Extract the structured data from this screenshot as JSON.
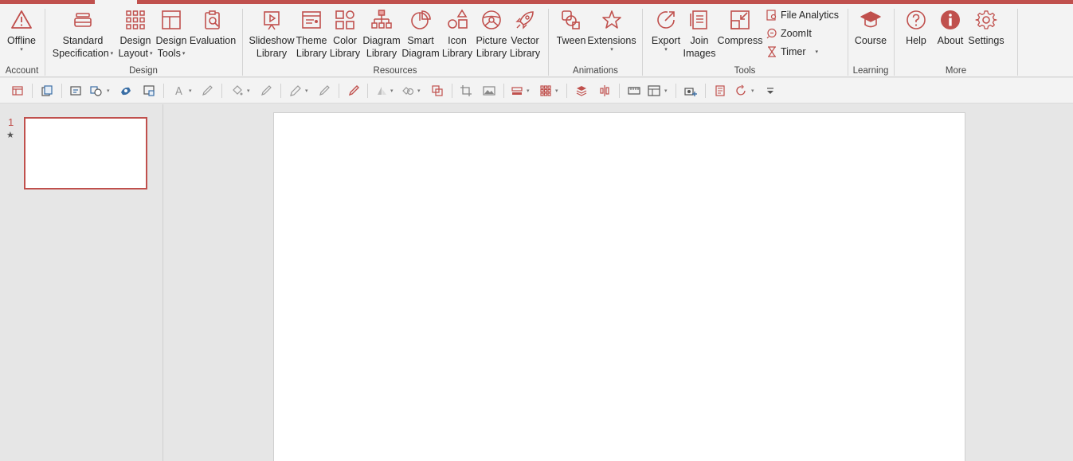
{
  "colors": {
    "accent": "#c0504d",
    "ribbon_bg": "#f3f3f3",
    "workspace_bg": "#e6e6e6"
  },
  "groups": {
    "account": "Account",
    "design": "Design",
    "resources": "Resources",
    "animations": "Animations",
    "tools": "Tools",
    "learning": "Learning",
    "more": "More"
  },
  "buttons": {
    "offline": {
      "line1": "Offline",
      "icon": "warning-triangle-icon"
    },
    "standard": {
      "line1": "Standard",
      "line2": "Specification"
    },
    "design_layout": {
      "line1": "Design",
      "line2": "Layout"
    },
    "design_tools": {
      "line1": "Design",
      "line2": "Tools"
    },
    "evaluation": {
      "line1": "Evaluation"
    },
    "slideshow_library": {
      "line1": "Slideshow",
      "line2": "Library"
    },
    "theme_library": {
      "line1": "Theme",
      "line2": "Library"
    },
    "color_library": {
      "line1": "Color",
      "line2": "Library"
    },
    "diagram_library": {
      "line1": "Diagram",
      "line2": "Library"
    },
    "smart_diagram": {
      "line1": "Smart",
      "line2": "Diagram"
    },
    "icon_library": {
      "line1": "Icon",
      "line2": "Library"
    },
    "picture_library": {
      "line1": "Picture",
      "line2": "Library"
    },
    "vector_library": {
      "line1": "Vector",
      "line2": "Library"
    },
    "tween": {
      "line1": "Tween"
    },
    "extensions": {
      "line1": "Extensions"
    },
    "export": {
      "line1": "Export"
    },
    "join_images": {
      "line1": "Join",
      "line2": "Images"
    },
    "compress": {
      "line1": "Compress"
    },
    "file_analytics": {
      "line1": "File Analytics"
    },
    "zoomit": {
      "line1": "ZoomIt"
    },
    "timer": {
      "line1": "Timer"
    },
    "course": {
      "line1": "Course"
    },
    "help": {
      "line1": "Help"
    },
    "about": {
      "line1": "About"
    },
    "settings": {
      "line1": "Settings"
    }
  },
  "slides": [
    {
      "number": "1",
      "starred": "★"
    }
  ]
}
